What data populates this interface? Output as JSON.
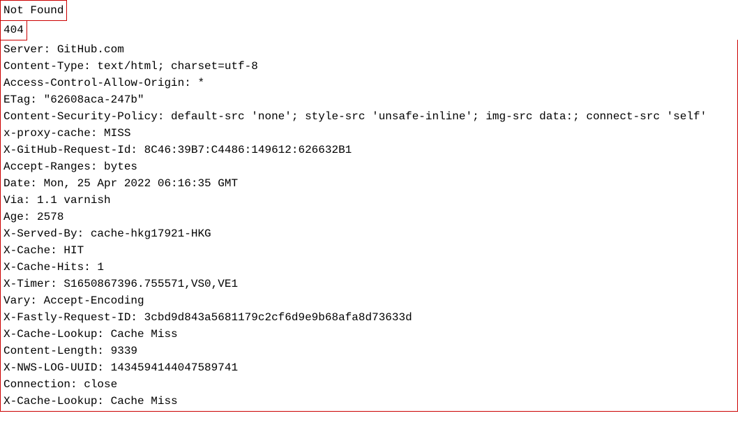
{
  "response": {
    "status_text": "Not Found",
    "status_code": "404",
    "headers": [
      "Server: GitHub.com",
      "Content-Type: text/html; charset=utf-8",
      "Access-Control-Allow-Origin: *",
      "ETag: \"62608aca-247b\"",
      "Content-Security-Policy: default-src 'none'; style-src 'unsafe-inline'; img-src data:; connect-src 'self'",
      "x-proxy-cache: MISS",
      "X-GitHub-Request-Id: 8C46:39B7:C4486:149612:626632B1",
      "Accept-Ranges: bytes",
      "Date: Mon, 25 Apr 2022 06:16:35 GMT",
      "Via: 1.1 varnish",
      "Age: 2578",
      "X-Served-By: cache-hkg17921-HKG",
      "X-Cache: HIT",
      "X-Cache-Hits: 1",
      "X-Timer: S1650867396.755571,VS0,VE1",
      "Vary: Accept-Encoding",
      "X-Fastly-Request-ID: 3cbd9d843a5681179c2cf6d9e9b68afa8d73633d",
      "X-Cache-Lookup: Cache Miss",
      "Content-Length: 9339",
      "X-NWS-LOG-UUID: 1434594144047589741",
      "Connection: close",
      "X-Cache-Lookup: Cache Miss"
    ]
  }
}
